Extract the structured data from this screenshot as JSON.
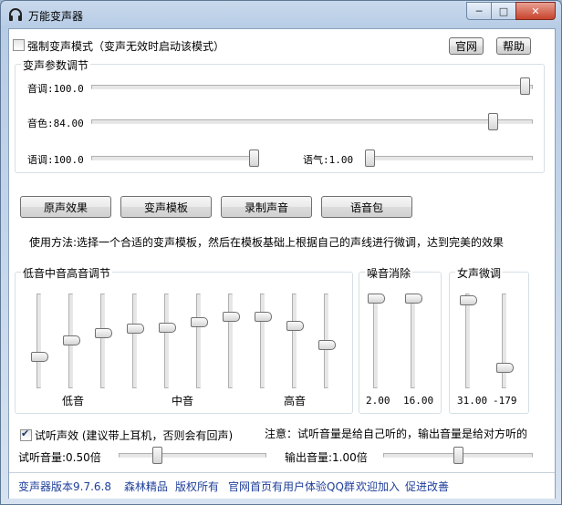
{
  "window": {
    "title": "万能变声器",
    "min_glyph": "─",
    "max_glyph": "□",
    "close_glyph": "✕"
  },
  "top": {
    "force_mode_label": "强制变声模式（变声无效时启动该模式）",
    "force_mode_checked": false,
    "official_site_button": "官网",
    "help_button": "帮助"
  },
  "params": {
    "title": "变声参数调节",
    "pitch_label": "音调:100.0",
    "pitch_value": 100.0,
    "timbre_label": "音色:84.00",
    "timbre_value": 84.0,
    "speed_label": "语调:100.0",
    "speed_value": 100.0,
    "tone_label": "语气:1.00",
    "tone_value": 1.0
  },
  "buttons": {
    "original_effect": "原声效果",
    "voice_template": "变声模板",
    "record_voice": "录制声音",
    "voice_pack": "语音包"
  },
  "usage_text": "使用方法:选择一个合适的变声模板，然后在模板基础上根据自己的声线进行微调，达到完美的效果",
  "eq": {
    "title": "低音中音高音调节",
    "low_label": "低音",
    "mid_label": "中音",
    "high_label": "高音",
    "levels": [
      0.3,
      0.5,
      0.59,
      0.64,
      0.65,
      0.72,
      0.78,
      0.78,
      0.67,
      0.45
    ]
  },
  "noise": {
    "title": "噪音消除",
    "value_left": "2.00",
    "value_right": "16.00",
    "levels": [
      1.0,
      1.0
    ]
  },
  "female": {
    "title": "女声微调",
    "value_left": "31.00",
    "value_right": "-179",
    "levels": [
      0.98,
      0.17
    ]
  },
  "monitor": {
    "label": "试听声效 (建议带上耳机，否则会有回声)",
    "checked": true,
    "note": "注意：试听音量是给自己听的，输出音量是给对方听的",
    "monitor_volume_label": "试听音量:0.50倍",
    "monitor_volume": 0.5,
    "output_volume_label": "输出音量:1.00倍",
    "output_volume": 1.0
  },
  "footer": {
    "version": "变声器版本9.7.6.8",
    "brand": "森林精品",
    "rights": "版权所有",
    "qq_group": "官网首页有用户体验QQ群",
    "join": "欢迎加入",
    "improve": "促进改善"
  }
}
